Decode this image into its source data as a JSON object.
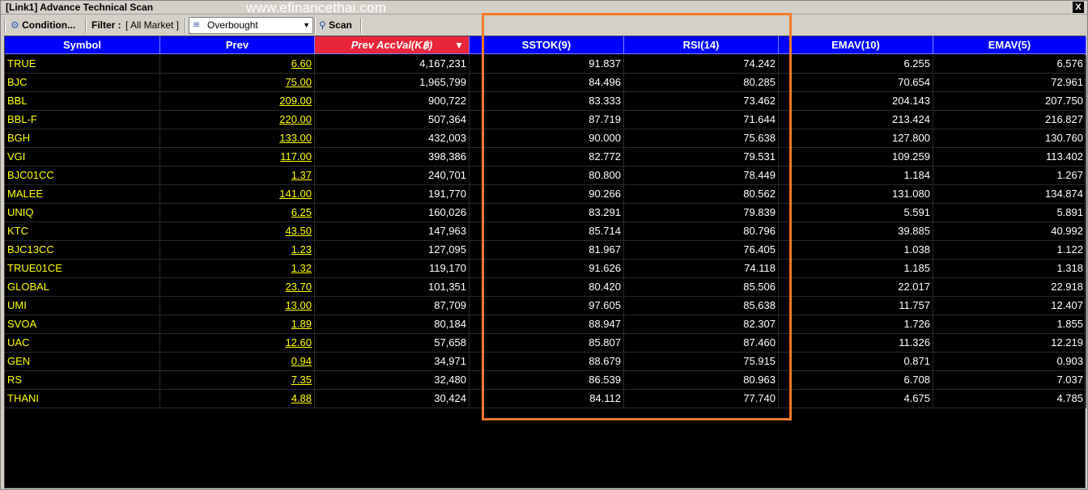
{
  "window": {
    "title": "[Link1] Advance Technical Scan",
    "watermark": "www.efinancethai.com",
    "close_label": "X"
  },
  "toolbar": {
    "condition_label": "Condition...",
    "filter_label": "Filter :",
    "filter_value": "[ All Market ]",
    "preset_value": "Overbought",
    "scan_label": "Scan"
  },
  "columns": [
    "Symbol",
    "Prev",
    "Prev AccVal(K฿)",
    "SSTOK(9)",
    "RSI(14)",
    "EMAV(10)",
    "EMAV(5)"
  ],
  "sorted_column": "Prev AccVal(K฿)",
  "rows": [
    {
      "symbol": "TRUE",
      "prev": "6.60",
      "accval": "4,167,231",
      "sstok": "91.837",
      "rsi": "74.242",
      "emav10": "6.255",
      "emav5": "6.576"
    },
    {
      "symbol": "BJC",
      "prev": "75.00",
      "accval": "1,965,799",
      "sstok": "84.496",
      "rsi": "80.285",
      "emav10": "70.654",
      "emav5": "72.961"
    },
    {
      "symbol": "BBL",
      "prev": "209.00",
      "accval": "900,722",
      "sstok": "83.333",
      "rsi": "73.462",
      "emav10": "204.143",
      "emav5": "207.750"
    },
    {
      "symbol": "BBL-F",
      "prev": "220.00",
      "accval": "507,364",
      "sstok": "87.719",
      "rsi": "71.644",
      "emav10": "213.424",
      "emav5": "216.827"
    },
    {
      "symbol": "BGH",
      "prev": "133.00",
      "accval": "432,003",
      "sstok": "90.000",
      "rsi": "75.638",
      "emav10": "127.800",
      "emav5": "130.760"
    },
    {
      "symbol": "VGI",
      "prev": "117.00",
      "accval": "398,386",
      "sstok": "82.772",
      "rsi": "79.531",
      "emav10": "109.259",
      "emav5": "113.402"
    },
    {
      "symbol": "BJC01CC",
      "prev": "1.37",
      "accval": "240,701",
      "sstok": "80.800",
      "rsi": "78.449",
      "emav10": "1.184",
      "emav5": "1.267"
    },
    {
      "symbol": "MALEE",
      "prev": "141.00",
      "accval": "191,770",
      "sstok": "90.266",
      "rsi": "80.562",
      "emav10": "131.080",
      "emav5": "134.874"
    },
    {
      "symbol": "UNIQ",
      "prev": "6.25",
      "accval": "160,026",
      "sstok": "83.291",
      "rsi": "79.839",
      "emav10": "5.591",
      "emav5": "5.891"
    },
    {
      "symbol": "KTC",
      "prev": "43.50",
      "accval": "147,963",
      "sstok": "85.714",
      "rsi": "80.796",
      "emav10": "39.885",
      "emav5": "40.992"
    },
    {
      "symbol": "BJC13CC",
      "prev": "1.23",
      "accval": "127,095",
      "sstok": "81.967",
      "rsi": "76.405",
      "emav10": "1.038",
      "emav5": "1.122"
    },
    {
      "symbol": "TRUE01CE",
      "prev": "1.32",
      "accval": "119,170",
      "sstok": "91.626",
      "rsi": "74.118",
      "emav10": "1.185",
      "emav5": "1.318"
    },
    {
      "symbol": "GLOBAL",
      "prev": "23.70",
      "accval": "101,351",
      "sstok": "80.420",
      "rsi": "85.506",
      "emav10": "22.017",
      "emav5": "22.918"
    },
    {
      "symbol": "UMI",
      "prev": "13.00",
      "accval": "87,709",
      "sstok": "97.605",
      "rsi": "85.638",
      "emav10": "11.757",
      "emav5": "12.407"
    },
    {
      "symbol": "SVOA",
      "prev": "1.89",
      "accval": "80,184",
      "sstok": "88.947",
      "rsi": "82.307",
      "emav10": "1.726",
      "emav5": "1.855"
    },
    {
      "symbol": "UAC",
      "prev": "12.60",
      "accval": "57,658",
      "sstok": "85.807",
      "rsi": "87.460",
      "emav10": "11.326",
      "emav5": "12.219"
    },
    {
      "symbol": "GEN",
      "prev": "0.94",
      "accval": "34,971",
      "sstok": "88.679",
      "rsi": "75.915",
      "emav10": "0.871",
      "emav5": "0.903"
    },
    {
      "symbol": "RS",
      "prev": "7.35",
      "accval": "32,480",
      "sstok": "86.539",
      "rsi": "80.963",
      "emav10": "6.708",
      "emav5": "7.037"
    },
    {
      "symbol": "THANI",
      "prev": "4.88",
      "accval": "30,424",
      "sstok": "84.112",
      "rsi": "77.740",
      "emav10": "4.675",
      "emav5": "4.785"
    }
  ],
  "colors": {
    "header_bg": "#0000ff",
    "sorted_header_bg": "#e8253a",
    "grid_bg": "#000000",
    "symbol_text": "#ffff00",
    "value_text": "#ffffff",
    "highlight_border": "#f47a2a"
  },
  "icons": {
    "condition": "condition-icon",
    "preset": "chart-icon",
    "scan": "magnifier-icon",
    "sort": "sort-desc-icon"
  }
}
